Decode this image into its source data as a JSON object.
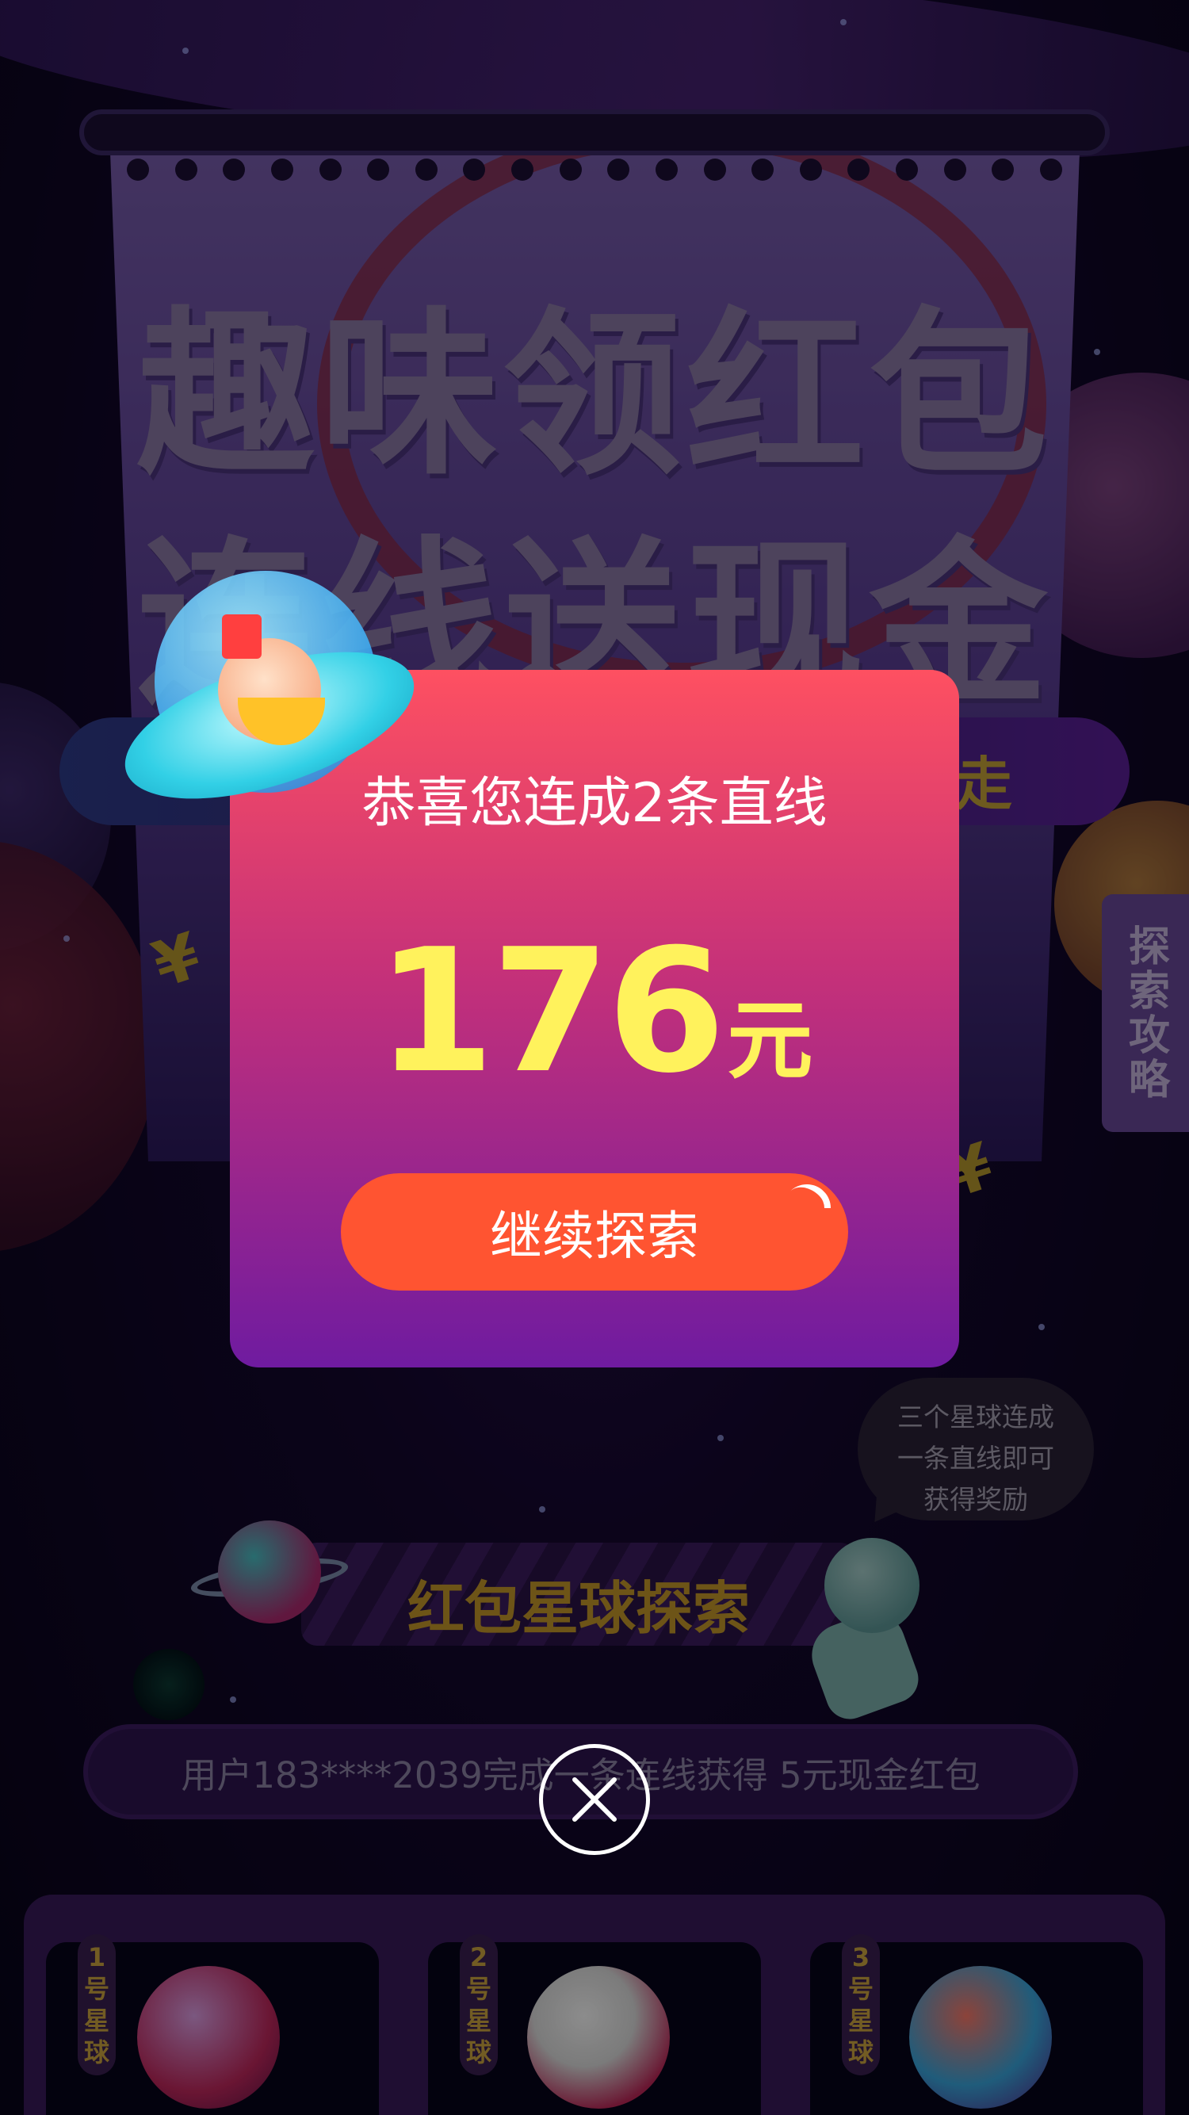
{
  "banner": {
    "title_line1": "趣味领红包",
    "title_line2": "连线送现金",
    "pill_partial_text": "走"
  },
  "side_tab": {
    "label": "探索攻略"
  },
  "hint_bubble": {
    "line1": "三个星球连成",
    "line2": "一条直线即可",
    "line3": "获得奖励"
  },
  "explore_section": {
    "title": "红包星球探索"
  },
  "notice": {
    "text": "用户183****2039完成一条连线获得 5元现金红包"
  },
  "planets": [
    {
      "tag_chars": [
        "1",
        "号",
        "星",
        "球"
      ],
      "color": "#c2285e"
    },
    {
      "tag_chars": [
        "2",
        "号",
        "星",
        "球"
      ],
      "color": "#e0e0e0"
    },
    {
      "tag_chars": [
        "3",
        "号",
        "星",
        "球"
      ],
      "color": "#3aa8e0"
    }
  ],
  "dialog": {
    "message": "恭喜您连成2条直线",
    "amount": "176",
    "unit": "元",
    "button_label": "继续探索"
  },
  "icons": {
    "currency": "¥",
    "close": "close-icon"
  },
  "colors": {
    "dialog_top": "#fe5061",
    "dialog_bottom": "#6f1ba0",
    "amount": "#fff25c",
    "button": "#ff5431",
    "accent_gold": "#c79a2a"
  }
}
